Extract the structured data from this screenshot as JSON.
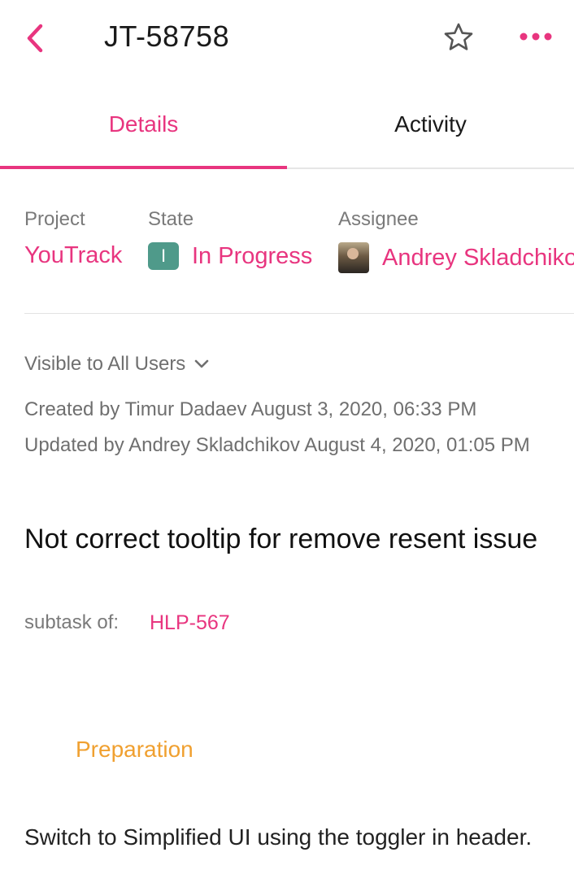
{
  "header": {
    "issue_id": "JT-58758",
    "icons": {
      "back": "chevron-left-icon",
      "star": "star-outline-icon",
      "more": "more-dots-icon"
    },
    "accent_color": "#e8357f"
  },
  "tabs": [
    {
      "label": "Details",
      "active": true
    },
    {
      "label": "Activity",
      "active": false
    }
  ],
  "fields": {
    "project": {
      "label": "Project",
      "value": "YouTrack"
    },
    "state": {
      "label": "State",
      "badge": "I",
      "value": "In Progress",
      "badge_color": "#4f9a8a"
    },
    "assignee": {
      "label": "Assignee",
      "value": "Andrey Skladchikov"
    }
  },
  "visibility": {
    "label": "Visible to All Users",
    "icon": "chevron-down-icon"
  },
  "meta": {
    "created": "Created by Timur Dadaev August 3, 2020, 06:33 PM",
    "updated": "Updated by Andrey Skladchikov August 4, 2020, 01:05 PM"
  },
  "summary": "Not correct tooltip for remove resent issue",
  "parent": {
    "label": "subtask of:",
    "issue": "HLP-567"
  },
  "description": {
    "heading": "Preparation",
    "heading_color": "#f0a030",
    "text": "Switch to Simplified UI using the toggler in header."
  }
}
